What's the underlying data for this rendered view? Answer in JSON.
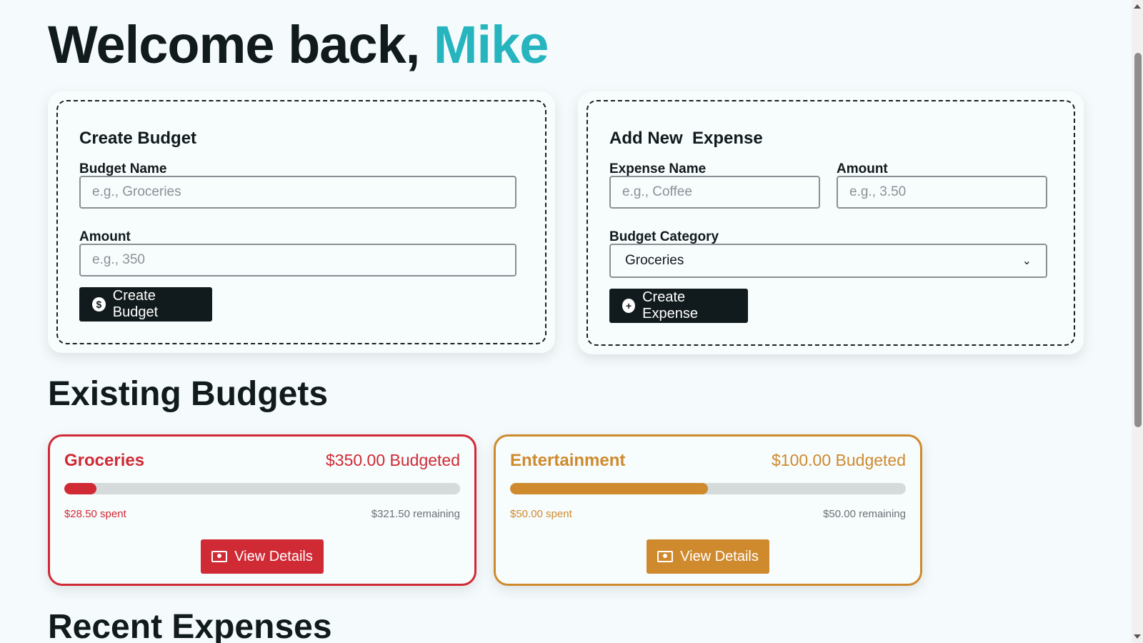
{
  "header": {
    "welcome_prefix": "Welcome back,",
    "user_name": "Mike"
  },
  "create_budget": {
    "title": "Create Budget",
    "name_label": "Budget Name",
    "name_placeholder": "e.g., Groceries",
    "amount_label": "Amount",
    "amount_placeholder": "e.g., 350",
    "button_label": "Create Budget",
    "button_icon": "dollar-circle-icon"
  },
  "add_expense": {
    "title": "Add New  Expense",
    "name_label": "Expense Name",
    "name_placeholder": "e.g., Coffee",
    "amount_label": "Amount",
    "amount_placeholder": "e.g., 3.50",
    "category_label": "Budget Category",
    "category_selected": "Groceries",
    "button_label": "Create Expense",
    "button_icon": "plus-circle-icon"
  },
  "existing_budgets": {
    "title": "Existing Budgets",
    "items": [
      {
        "name": "Groceries",
        "budgeted": "$350.00 Budgeted",
        "spent": "$28.50 spent",
        "remaining": "$321.50 remaining",
        "progress": 0.0814,
        "color": "#d02a35",
        "button_label": "View Details",
        "button_icon": "money-bill-icon"
      },
      {
        "name": "Entertainment",
        "budgeted": "$100.00 Budgeted",
        "spent": "$50.00 spent",
        "remaining": "$50.00 remaining",
        "progress": 0.5,
        "color": "#cf8a2e",
        "button_label": "View Details",
        "button_icon": "money-bill-icon"
      }
    ]
  },
  "recent_expenses": {
    "title": "Recent Expenses"
  },
  "colors": {
    "accent": "#26b4bf",
    "dark": "#111a1c",
    "background": "#f5fbfc"
  }
}
